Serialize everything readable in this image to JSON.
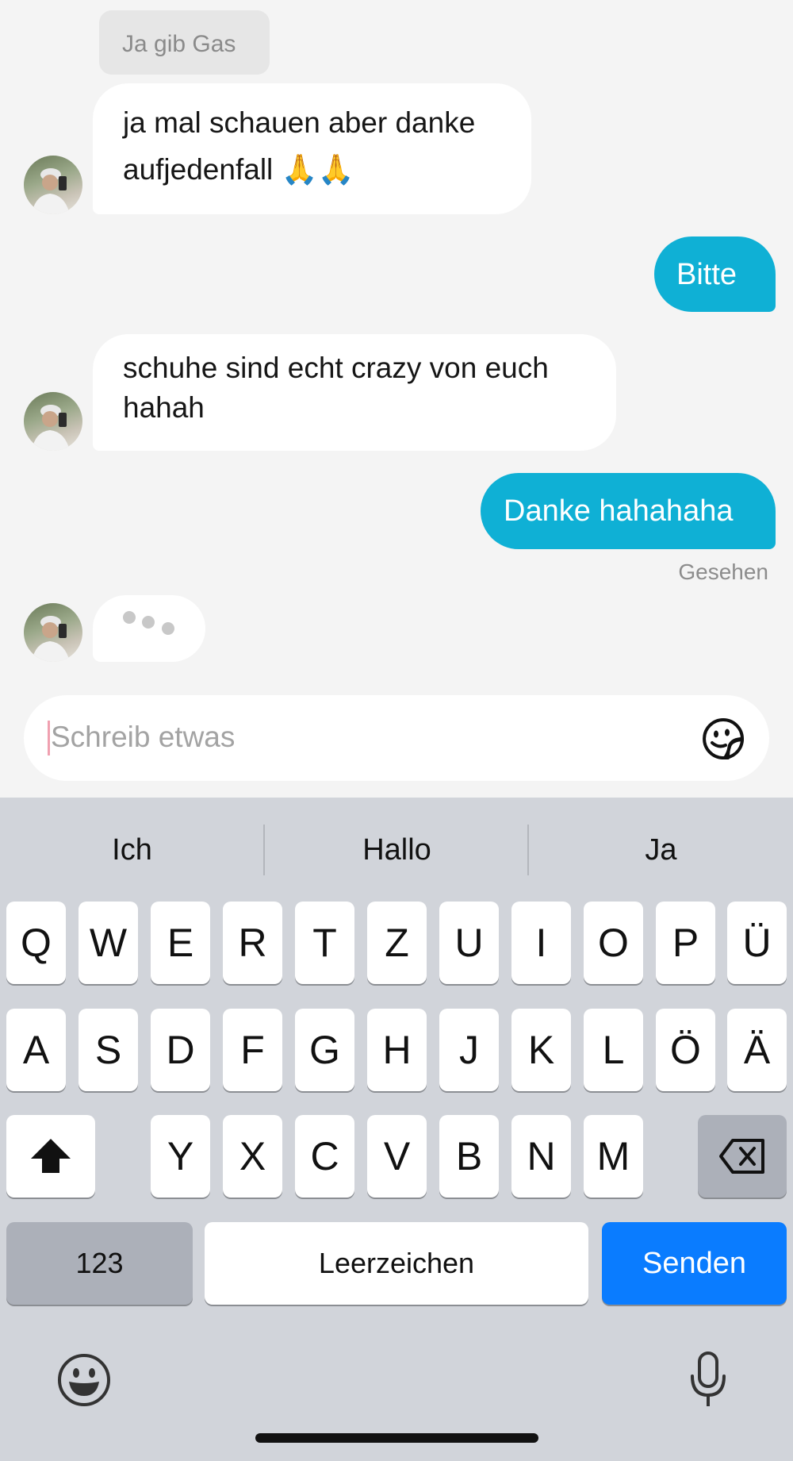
{
  "messages": {
    "quote": "Ja gib Gas",
    "incoming_1_line1": "ja mal schauen aber danke",
    "incoming_1_line2": "aufjedenfall 🙏🙏",
    "outgoing_1": "Bitte",
    "incoming_2_line1": "schuhe sind echt crazy von euch",
    "incoming_2_line2": "hahah",
    "outgoing_2": "Danke hahahaha",
    "seen_status": "Gesehen"
  },
  "composer": {
    "placeholder": "Schreib etwas",
    "sticker_icon": "sticker-icon"
  },
  "keyboard": {
    "suggestions": [
      "Ich",
      "Hallo",
      "Ja"
    ],
    "row1": [
      "Q",
      "W",
      "E",
      "R",
      "T",
      "Z",
      "U",
      "I",
      "O",
      "P",
      "Ü"
    ],
    "row2": [
      "A",
      "S",
      "D",
      "F",
      "G",
      "H",
      "J",
      "K",
      "L",
      "Ö",
      "Ä"
    ],
    "row3": [
      "Y",
      "X",
      "C",
      "V",
      "B",
      "N",
      "M"
    ],
    "numbers_label": "123",
    "space_label": "Leerzeichen",
    "send_label": "Senden",
    "shift_icon": "shift-icon",
    "backspace_icon": "backspace-icon",
    "emoji_icon": "emoji-icon",
    "mic_icon": "microphone-icon"
  },
  "colors": {
    "outgoing_bubble": "#0fb0d5",
    "send_key": "#0a7cff",
    "background": "#f4f4f4"
  }
}
